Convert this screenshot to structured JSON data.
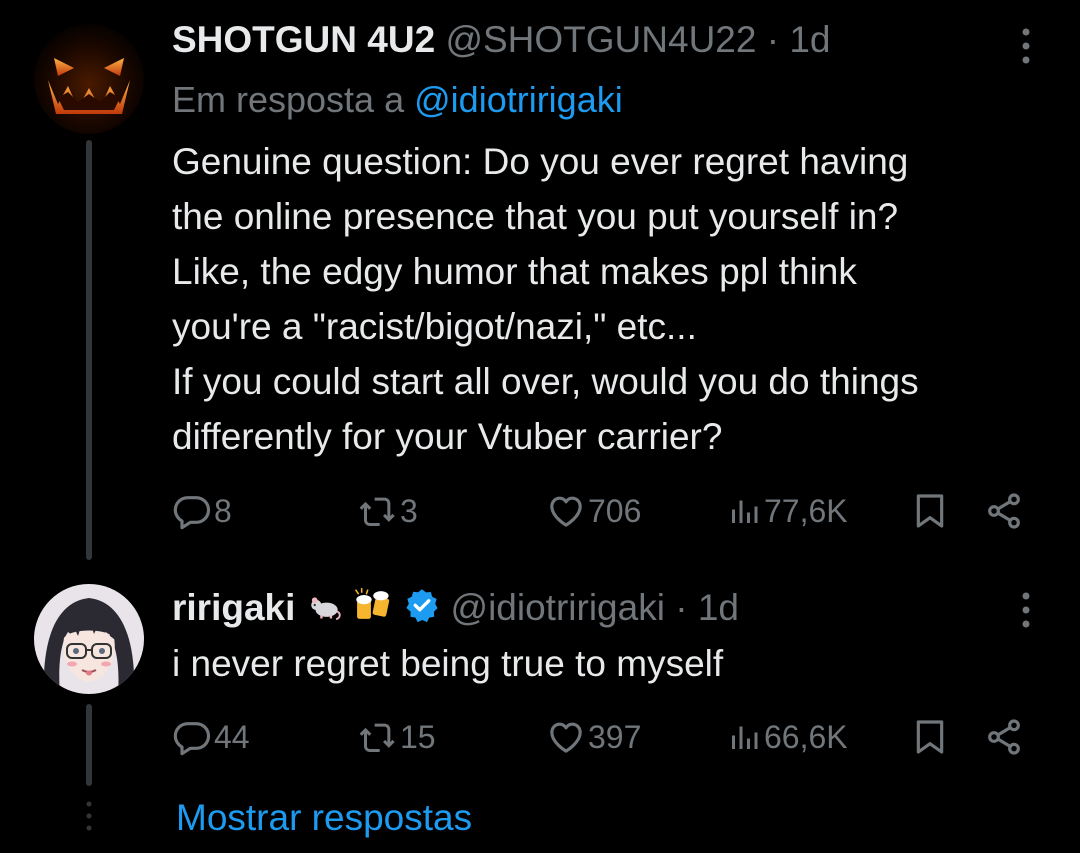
{
  "tweet1": {
    "display_name": "SHOTGUN 4U2",
    "handle": "@SHOTGUN4U22",
    "separator": "·",
    "time": "1d",
    "reply_prefix": "Em resposta a",
    "reply_mention": "@idiotririgaki",
    "text": "Genuine question: Do you ever regret having\nthe online presence that you put yourself in?\nLike, the edgy humor that makes ppl think\nyou're a \"racist/bigot/nazi,\" etc...\nIf you could start all over, would you do things\ndifferently for your Vtuber carrier?",
    "replies": "8",
    "reposts": "3",
    "likes": "706",
    "views": "77,6K"
  },
  "tweet2": {
    "display_name": "ririgaki",
    "handle": "@idiotririgaki",
    "separator": "·",
    "time": "1d",
    "text": "i never regret being true to myself",
    "replies": "44",
    "reposts": "15",
    "likes": "397",
    "views": "66,6K"
  },
  "show_replies": "Mostrar respostas",
  "icons": {
    "reply": "reply-icon",
    "repost": "repost-icon",
    "like": "heart-icon",
    "views": "views-icon",
    "bookmark": "bookmark-icon",
    "share": "share-icon",
    "more": "more-icon",
    "verified": "verified-badge-icon",
    "emoji1": "rat-emoji-icon",
    "emoji2": "beer-mugs-emoji-icon"
  },
  "colors": {
    "background": "#000000",
    "text": "#e7e9ea",
    "muted": "#71767b",
    "accent": "#1d9bf0",
    "thread_line": "#333639"
  }
}
